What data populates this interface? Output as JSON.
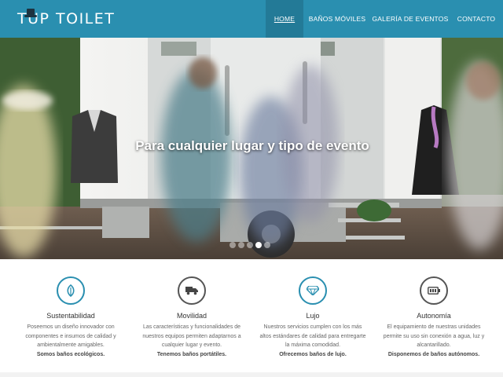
{
  "brand": {
    "name": "TUP TOILET",
    "logo_icon": "top-hat-icon",
    "color": "#2a8fb0"
  },
  "nav": {
    "items": [
      {
        "label": "HOME",
        "active": true
      },
      {
        "label": "BAÑOS MÓVILES",
        "active": false
      },
      {
        "label": "GALERÍA DE EVENTOS",
        "active": false
      },
      {
        "label": "CONTACTO",
        "active": false
      }
    ]
  },
  "hero": {
    "title": "Para cualquier lugar y tipo de evento",
    "slides_total": 5,
    "active_slide": 4
  },
  "features": [
    {
      "icon": "leaf-icon",
      "title": "Sustentabilidad",
      "lines": [
        "Poseemos un diseño innovador con",
        "componentes e insumos de calidad y",
        "ambientalmente amigables."
      ],
      "bold": "Somos baños ecológicos."
    },
    {
      "icon": "truck-icon",
      "title": "Movilidad",
      "lines": [
        "Las características y funcionalidades de",
        "nuestros equipos permiten adaptarnos a",
        "cualquier lugar y evento."
      ],
      "bold": "Tenemos baños portátiles."
    },
    {
      "icon": "diamond-icon",
      "title": "Lujo",
      "lines": [
        "Nuestros servicios cumplen con los más",
        "altos estándares de calidad para entregarte",
        "la máxima comodidad."
      ],
      "bold": "Ofrecemos baños de lujo."
    },
    {
      "icon": "battery-icon",
      "title": "Autonomía",
      "lines": [
        "El equipamiento de nuestras unidades",
        "permite su uso sin conexión a agua, luz y",
        "alcantarillado."
      ],
      "bold": "Disponemos de baños autónomos."
    }
  ]
}
